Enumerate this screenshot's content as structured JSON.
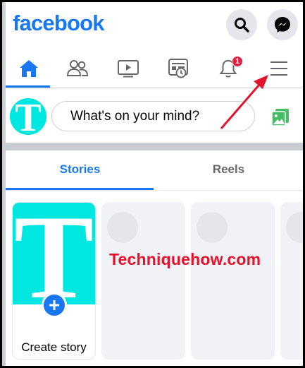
{
  "header": {
    "logo_text": "facebook",
    "brand_color": "#1877f2",
    "actions": [
      {
        "name": "search",
        "icon": "search-icon"
      },
      {
        "name": "messenger",
        "icon": "messenger-icon"
      }
    ]
  },
  "nav": {
    "tabs": [
      {
        "name": "home",
        "icon": "home-icon",
        "active": true
      },
      {
        "name": "friends",
        "icon": "friends-icon",
        "active": false
      },
      {
        "name": "watch",
        "icon": "video-icon",
        "active": false
      },
      {
        "name": "news",
        "icon": "newsfeed-clock-icon",
        "active": false
      },
      {
        "name": "notifications",
        "icon": "bell-icon",
        "active": false,
        "badge": "1"
      },
      {
        "name": "menu",
        "icon": "hamburger-menu-icon",
        "active": false
      }
    ]
  },
  "composer": {
    "avatar_letter": "T",
    "placeholder": "What's on your mind?",
    "photo_icon": "photo-icon",
    "avatar_color": "#00e6e0"
  },
  "stories": {
    "tabs": [
      "Stories",
      "Reels"
    ],
    "active_tab": "Stories",
    "create_story_label": "Create story",
    "create_art_letter": "T",
    "plus_icon": "plus-icon"
  },
  "watermark": {
    "text": "Techniquehow.com",
    "color": "#e4132b"
  },
  "annotation": {
    "type": "red-arrow",
    "points_to": "hamburger-menu-icon",
    "color": "#e4132b"
  }
}
